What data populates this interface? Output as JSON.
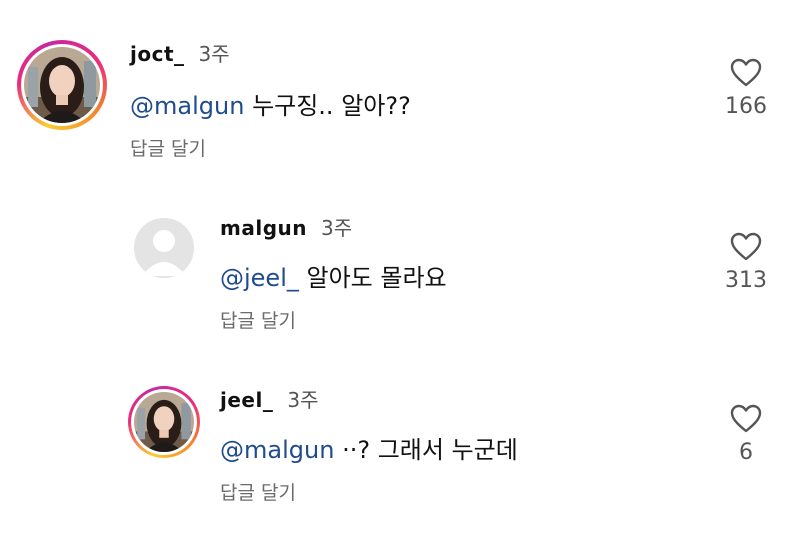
{
  "comments": [
    {
      "username": "joct_",
      "time": "3주",
      "mention": "@malgun",
      "text": "누구징.. 알아??",
      "reply_label": "답글 달기",
      "likes": "166",
      "avatar": "photo",
      "story_ring": true
    },
    {
      "username": "malgun",
      "time": "3주",
      "mention": "@jeel_",
      "text": "알아도 몰라요",
      "reply_label": "답글 달기",
      "likes": "313",
      "avatar": "default",
      "story_ring": false
    },
    {
      "username": "jeel_",
      "time": "3주",
      "mention": "@malgun",
      "text": "··? 그래서 누군데",
      "reply_label": "답글 달기",
      "likes": "6",
      "avatar": "photo",
      "story_ring": true
    }
  ],
  "colors": {
    "mention": "#1f4b8f",
    "story_ring": [
      "#f9ce34",
      "#ee2a7b",
      "#c32aa3"
    ],
    "secondary_text": "#6b6b6b"
  },
  "icons": {
    "like": "heart-outline-icon",
    "default_avatar": "default-avatar-icon"
  }
}
